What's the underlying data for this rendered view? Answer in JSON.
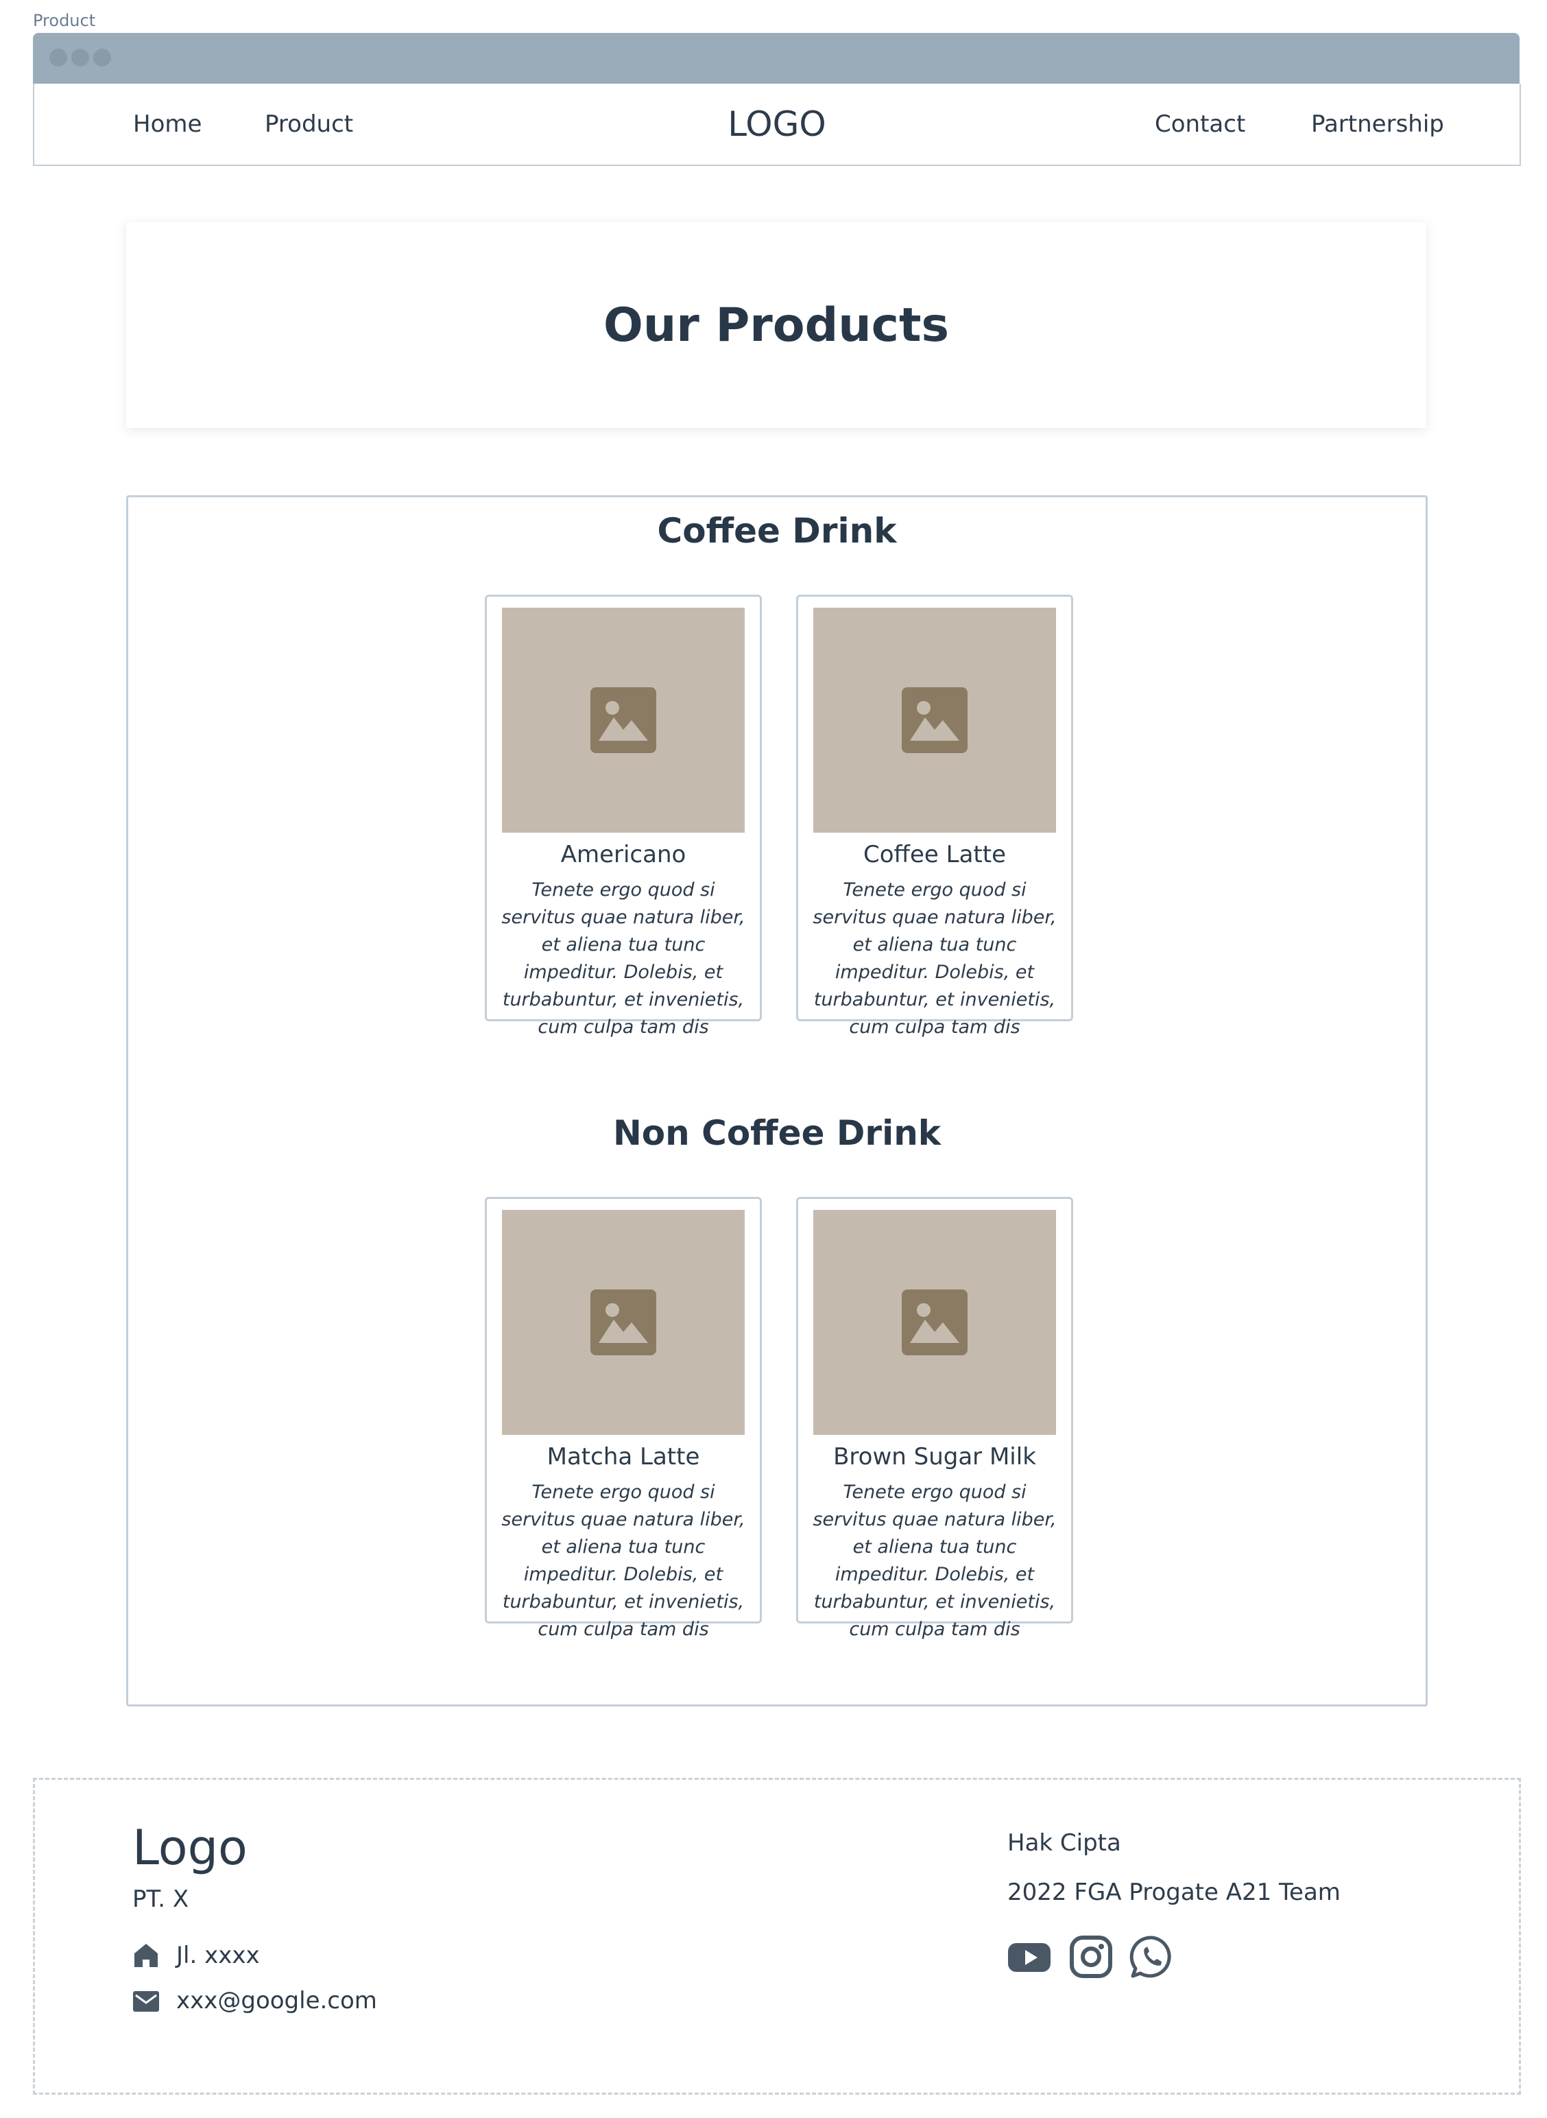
{
  "frame": {
    "label": "Product"
  },
  "nav": {
    "home": "Home",
    "product": "Product",
    "logo": "LOGO",
    "contact": "Contact",
    "partnership": "Partnership"
  },
  "hero": {
    "title": "Our Products"
  },
  "sections": [
    {
      "title": "Coffee Drink",
      "items": [
        {
          "name": "Americano",
          "description": "Tenete ergo quod si servitus quae natura liber, et aliena tua tunc impeditur. Dolebis, et turbabuntur, et invenietis, cum culpa tam dis"
        },
        {
          "name": "Coffee Latte",
          "description": "Tenete ergo quod si servitus quae natura liber, et aliena tua tunc impeditur. Dolebis, et turbabuntur, et invenietis, cum culpa tam dis"
        }
      ]
    },
    {
      "title": "Non Coffee Drink",
      "items": [
        {
          "name": "Matcha Latte",
          "description": "Tenete ergo quod si servitus quae natura liber, et aliena tua tunc impeditur. Dolebis, et turbabuntur, et invenietis, cum culpa tam dis"
        },
        {
          "name": "Brown Sugar Milk",
          "description": "Tenete ergo quod si servitus quae natura liber, et aliena tua tunc impeditur. Dolebis, et turbabuntur, et invenietis, cum culpa tam dis"
        }
      ]
    }
  ],
  "footer": {
    "logo": "Logo",
    "company": "PT. X",
    "address": "Jl. xxxx",
    "email": "xxx@google.com",
    "copyright_label": "Hak Cipta",
    "copyright_text": "2022 FGA Progate A21 Team",
    "social_icons": [
      "youtube-icon",
      "instagram-icon",
      "whatsapp-icon"
    ]
  },
  "colors": {
    "titlebar": "#9aabb9",
    "text": "#2d3b4a",
    "border": "#c3ced8",
    "placeholder_bg": "#c4bbae",
    "placeholder_icon": "#8b7b63"
  }
}
